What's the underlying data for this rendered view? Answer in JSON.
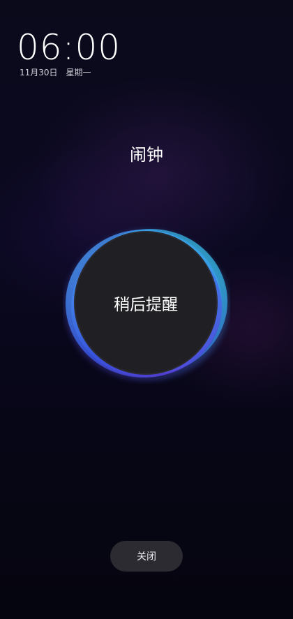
{
  "lockscreen": {
    "time": "06:00",
    "date": "11月30日",
    "weekday": "星期一"
  },
  "alarm": {
    "title": "闹钟",
    "snooze_label": "稍后提醒",
    "close_label": "关闭"
  }
}
